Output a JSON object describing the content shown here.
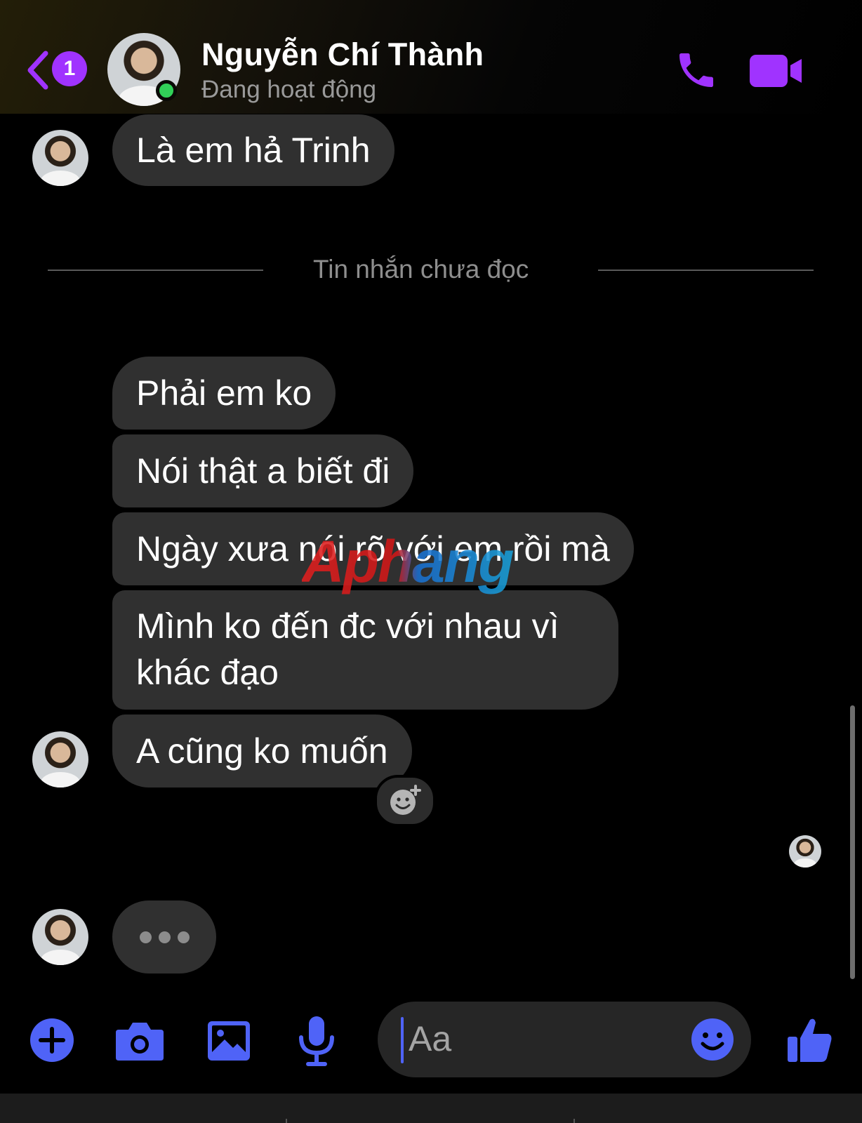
{
  "header": {
    "back_badge_count": "1",
    "contact_name": "Nguyễn Chí Thành",
    "status": "Đang hoạt động",
    "call_icon": "phone-icon",
    "video_icon": "video-camera-icon",
    "accent_color": "#a033ff"
  },
  "messages": {
    "first": "Là em hả Trinh",
    "divider": "Tin nhắn chưa đọc",
    "m1": "Phải em ko",
    "m2": "Nói thật a biết đi",
    "m3": "Ngày xưa nói rõ với em rồi mà",
    "m4_line1": "Mình ko đến đc với nhau vì",
    "m4_line2": "khác đạo",
    "m5": "A cũng ko muốn"
  },
  "watermark": "Aphang",
  "composer": {
    "placeholder": "Aa",
    "accent_color": "#4f63f7",
    "icons": [
      "plus-icon",
      "camera-icon",
      "gallery-icon",
      "microphone-icon",
      "emoji-icon",
      "thumbs-up-icon"
    ]
  }
}
